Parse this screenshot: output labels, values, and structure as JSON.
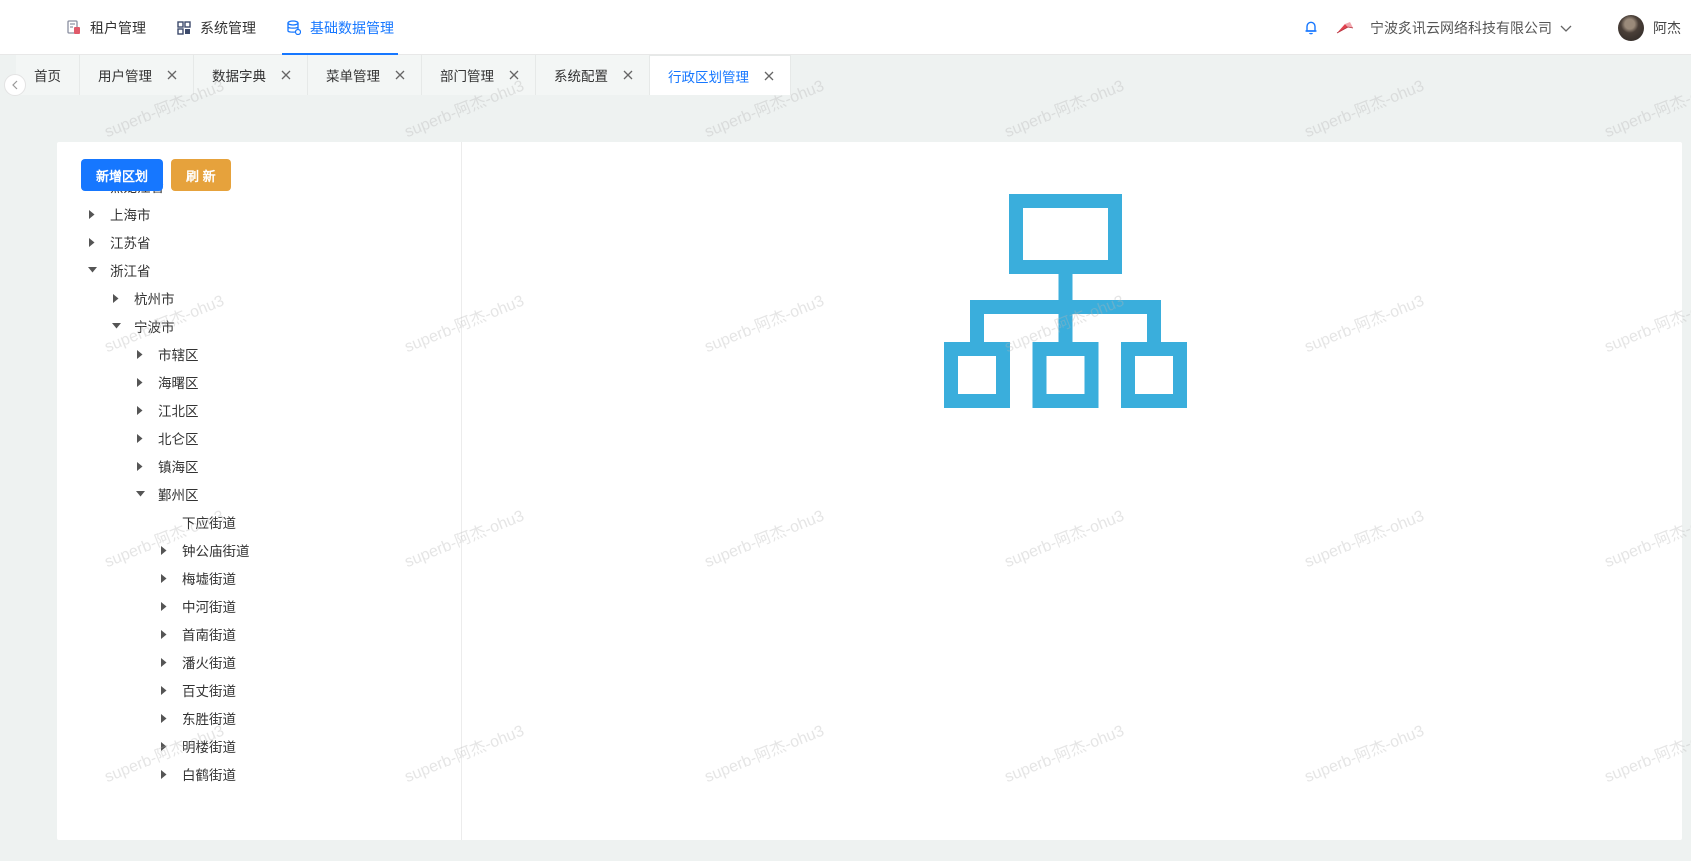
{
  "header": {
    "menu": [
      {
        "label": "租户管理",
        "icon": "tenant-icon",
        "active": false
      },
      {
        "label": "系统管理",
        "icon": "system-icon",
        "active": false
      },
      {
        "label": "基础数据管理",
        "icon": "database-icon",
        "active": true
      }
    ],
    "company": "宁波炙讯云网络科技有限公司",
    "user_name": "阿杰"
  },
  "tabs": [
    {
      "label": "首页",
      "closable": false,
      "active": false
    },
    {
      "label": "用户管理",
      "closable": true,
      "active": false
    },
    {
      "label": "数据字典",
      "closable": true,
      "active": false
    },
    {
      "label": "菜单管理",
      "closable": true,
      "active": false
    },
    {
      "label": "部门管理",
      "closable": true,
      "active": false
    },
    {
      "label": "系统配置",
      "closable": true,
      "active": false
    },
    {
      "label": "行政区划管理",
      "closable": true,
      "active": true
    }
  ],
  "actions": {
    "add_label": "新增区划",
    "refresh_label": "刷 新"
  },
  "tree": [
    {
      "label": "黑龙江省",
      "level": 0,
      "state": "collapsed"
    },
    {
      "label": "上海市",
      "level": 0,
      "state": "collapsed"
    },
    {
      "label": "江苏省",
      "level": 0,
      "state": "collapsed"
    },
    {
      "label": "浙江省",
      "level": 0,
      "state": "expanded"
    },
    {
      "label": "杭州市",
      "level": 1,
      "state": "collapsed"
    },
    {
      "label": "宁波市",
      "level": 1,
      "state": "expanded"
    },
    {
      "label": "市辖区",
      "level": 2,
      "state": "collapsed"
    },
    {
      "label": "海曙区",
      "level": 2,
      "state": "collapsed"
    },
    {
      "label": "江北区",
      "level": 2,
      "state": "collapsed"
    },
    {
      "label": "北仑区",
      "level": 2,
      "state": "collapsed"
    },
    {
      "label": "镇海区",
      "level": 2,
      "state": "collapsed"
    },
    {
      "label": "鄞州区",
      "level": 2,
      "state": "expanded"
    },
    {
      "label": "下应街道",
      "level": 3,
      "state": "leaf"
    },
    {
      "label": "钟公庙街道",
      "level": 3,
      "state": "collapsed"
    },
    {
      "label": "梅墟街道",
      "level": 3,
      "state": "collapsed"
    },
    {
      "label": "中河街道",
      "level": 3,
      "state": "collapsed"
    },
    {
      "label": "首南街道",
      "level": 3,
      "state": "collapsed"
    },
    {
      "label": "潘火街道",
      "level": 3,
      "state": "collapsed"
    },
    {
      "label": "百丈街道",
      "level": 3,
      "state": "collapsed"
    },
    {
      "label": "东胜街道",
      "level": 3,
      "state": "collapsed"
    },
    {
      "label": "明楼街道",
      "level": 3,
      "state": "collapsed"
    },
    {
      "label": "白鹤街道",
      "level": 3,
      "state": "collapsed"
    }
  ],
  "watermark": "superb-阿杰-ohu3",
  "colors": {
    "primary": "#1677ff",
    "warning": "#e6a23c",
    "org_graphic": "#3aaedc"
  }
}
